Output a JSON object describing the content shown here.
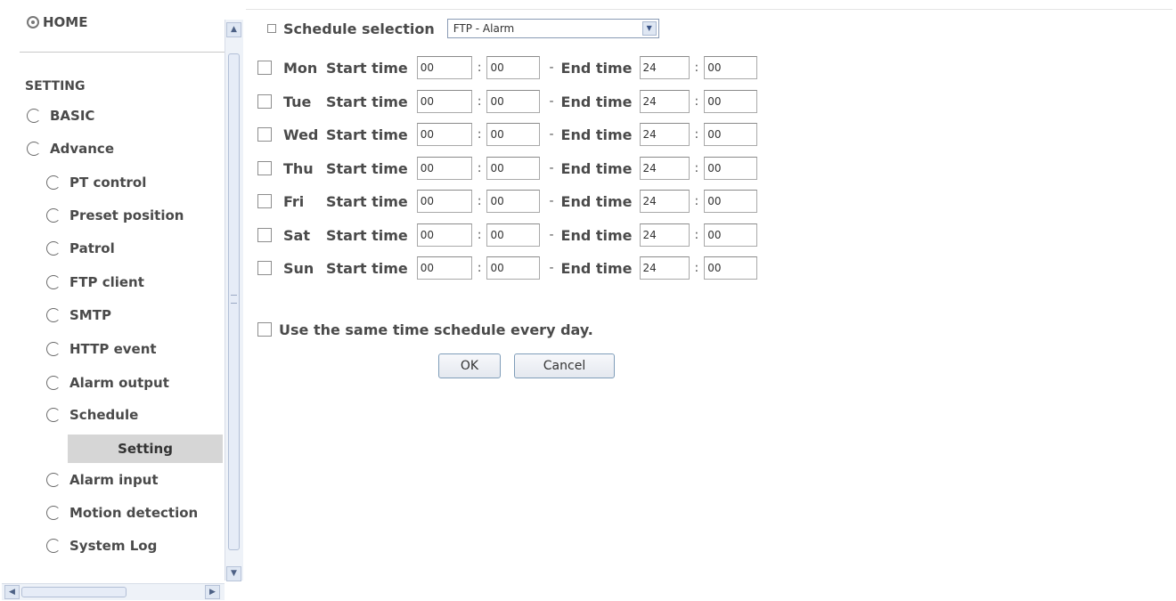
{
  "sidebar": {
    "home_label": "HOME",
    "section_label": "SETTING",
    "items": [
      {
        "label": "BASIC"
      },
      {
        "label": "Advance"
      },
      {
        "label": "PT control"
      },
      {
        "label": "Preset position"
      },
      {
        "label": "Patrol"
      },
      {
        "label": "FTP client"
      },
      {
        "label": "SMTP"
      },
      {
        "label": "HTTP event"
      },
      {
        "label": "Alarm output"
      },
      {
        "label": "Schedule"
      },
      {
        "label": "Alarm input"
      },
      {
        "label": "Motion detection"
      },
      {
        "label": "System Log"
      }
    ],
    "active_item": "Setting"
  },
  "schedule": {
    "label": "Schedule selection",
    "selected": "FTP - Alarm"
  },
  "labels": {
    "start_time": "Start time",
    "end_time": "End time",
    "colon": ":",
    "dash": "-"
  },
  "days": [
    {
      "name": "Mon",
      "start_h": "00",
      "start_m": "00",
      "end_h": "24",
      "end_m": "00"
    },
    {
      "name": "Tue",
      "start_h": "00",
      "start_m": "00",
      "end_h": "24",
      "end_m": "00"
    },
    {
      "name": "Wed",
      "start_h": "00",
      "start_m": "00",
      "end_h": "24",
      "end_m": "00"
    },
    {
      "name": "Thu",
      "start_h": "00",
      "start_m": "00",
      "end_h": "24",
      "end_m": "00"
    },
    {
      "name": "Fri",
      "start_h": "00",
      "start_m": "00",
      "end_h": "24",
      "end_m": "00"
    },
    {
      "name": "Sat",
      "start_h": "00",
      "start_m": "00",
      "end_h": "24",
      "end_m": "00"
    },
    {
      "name": "Sun",
      "start_h": "00",
      "start_m": "00",
      "end_h": "24",
      "end_m": "00"
    }
  ],
  "same_schedule_label": "Use the same time schedule every day.",
  "buttons": {
    "ok": "OK",
    "cancel": "Cancel"
  }
}
